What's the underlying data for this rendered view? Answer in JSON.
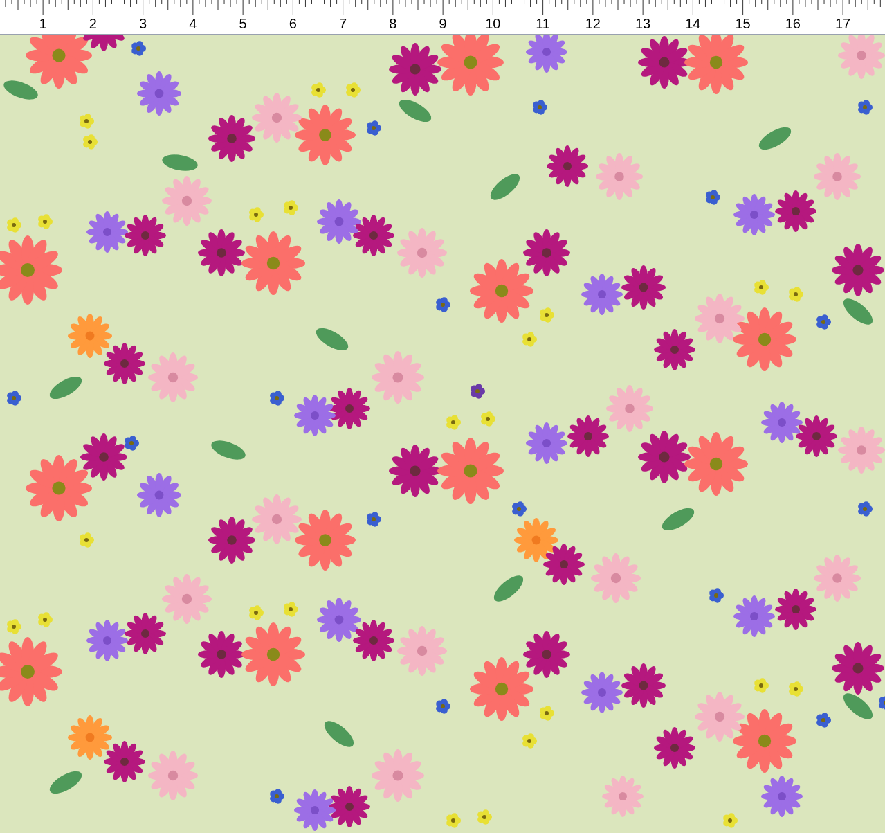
{
  "ruler": {
    "labels": [
      "1",
      "2",
      "3",
      "4",
      "5",
      "6",
      "7",
      "8",
      "9",
      "10",
      "11",
      "12",
      "13",
      "14",
      "15",
      "16",
      "17"
    ]
  }
}
